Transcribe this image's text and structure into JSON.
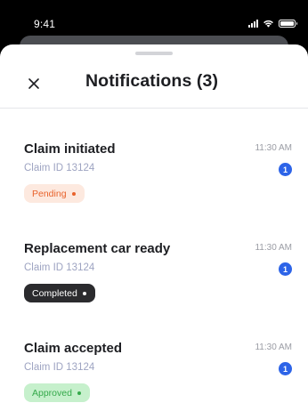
{
  "status_bar": {
    "time": "9:41",
    "icons": [
      "cellular-signal-icon",
      "wifi-icon",
      "battery-icon"
    ]
  },
  "header": {
    "title": "Notifications (3)",
    "close_icon": "close-icon"
  },
  "notifications": [
    {
      "title": "Claim initiated",
      "subtitle": "Claim ID 13124",
      "time": "11:30 AM",
      "count": "1",
      "status": "Pending",
      "status_color": "#E8622B"
    },
    {
      "title": "Replacement car ready",
      "subtitle": "Claim ID 13124",
      "time": "11:30 AM",
      "count": "1",
      "status": "Completed",
      "status_color": "#2B2B2E"
    },
    {
      "title": "Claim accepted",
      "subtitle": "Claim ID 13124",
      "time": "11:30 AM",
      "count": "1",
      "status": "Approved",
      "status_color": "#34A94A"
    }
  ],
  "colors": {
    "badge": "#2D64E8",
    "title_text": "#1D1E22",
    "subtitle_text": "#9EA4C2"
  }
}
